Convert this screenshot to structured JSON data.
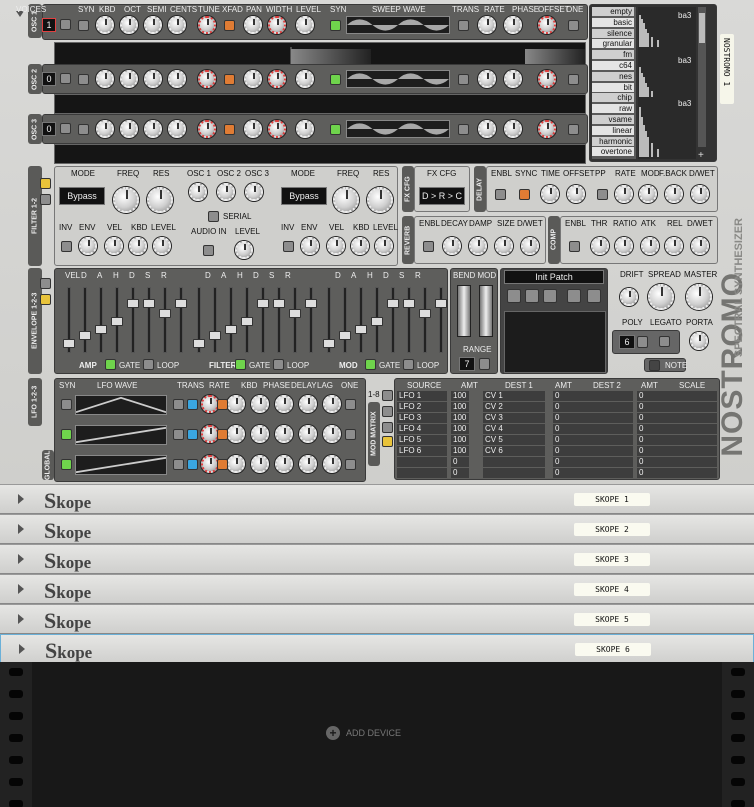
{
  "osc_labels": {
    "voices": "VOICES",
    "syn": "SYN",
    "kbd": "KBD",
    "oct": "OCT",
    "semi": "SEMI",
    "cents": "CENTS",
    "tune": "TUNE",
    "xfad": "XFAD",
    "pan": "PAN",
    "width": "WIDTH",
    "level": "LEVEL",
    "syn2": "SYN",
    "sweep": "SWEEP WAVE",
    "trans": "TRANS",
    "rate": "RATE",
    "phase": "PHASE",
    "offset": "OFFSET",
    "one": "ONE"
  },
  "osc": [
    {
      "tab": "OSC 1",
      "value": "1"
    },
    {
      "tab": "OSC 2",
      "value": "0"
    },
    {
      "tab": "OSC 3",
      "value": "0"
    }
  ],
  "wavelist": [
    "empty",
    "basic",
    "silence",
    "granular",
    "fm",
    "c64",
    "nes",
    "bit",
    "chip",
    "raw",
    "vsame",
    "linear",
    "harmonic",
    "overtone"
  ],
  "wavelist_right": [
    "ba3",
    "ba3",
    "ba3"
  ],
  "nostromo_label": "NOSTROMO 1",
  "filter": {
    "tab": "FILTER 1-2",
    "mode": "MODE",
    "freq": "FREQ",
    "res": "RES",
    "bypass1": "Bypass",
    "bypass2": "Bypass",
    "inv": "INV",
    "env": "ENV",
    "vel": "VEL",
    "kbd": "KBD",
    "level": "LEVEL",
    "osc1": "OSC 1",
    "osc2": "OSC 2",
    "osc3": "OSC 3",
    "serial": "SERIAL",
    "audio_in": "AUDIO IN",
    "level2": "LEVEL"
  },
  "fxcfg": {
    "tab": "FX CFG",
    "label": "FX CFG",
    "value": "D > R > C"
  },
  "delay": {
    "tab": "DELAY",
    "enbl": "ENBL",
    "sync": "SYNC",
    "time": "TIME",
    "offset": "OFFSET",
    "pp": "PP",
    "rate": "RATE",
    "mod": "MOD",
    "fback": "F.BACK",
    "dwet": "D/WET"
  },
  "reverb": {
    "tab": "REVERB",
    "enbl": "ENBL",
    "decay": "DECAY",
    "damp": "DAMP",
    "size": "SIZE",
    "dwet": "D/WET"
  },
  "comp": {
    "tab": "COMP",
    "enbl": "ENBL",
    "thr": "THR",
    "ratio": "RATIO",
    "atk": "ATK",
    "rel": "REL",
    "dwet": "D/WET"
  },
  "envelope": {
    "tab": "ENVELOPE 1-2-3",
    "cols": [
      "VEL",
      "D",
      "A",
      "H",
      "D",
      "S",
      "R"
    ],
    "amp": "AMP",
    "filter": "FILTER",
    "mod": "MOD",
    "gate": "GATE",
    "loop": "LOOP"
  },
  "bend": {
    "label": "BEND MOD",
    "range": "RANGE",
    "range_value": "7"
  },
  "patch": {
    "name": "Init Patch"
  },
  "master": {
    "drift": "DRIFT",
    "spread": "SPREAD",
    "master": "MASTER",
    "poly": "POLY",
    "legato": "LEGATO",
    "porta": "PORTA",
    "poly_value": "6",
    "note": "NOTE"
  },
  "lfo": {
    "tab": "LFO 1-2-3",
    "global": "GLOBAL",
    "syn": "SYN",
    "wave": "LFO WAVE",
    "trans": "TRANS",
    "rate": "RATE",
    "kbd": "KBD",
    "phase": "PHASE",
    "delay": "DELAY",
    "lag": "LAG",
    "one": "ONE"
  },
  "modmatrix": {
    "tab": "MOD MATRIX",
    "tab2": "1-8",
    "headers": [
      "SOURCE",
      "AMT",
      "DEST 1",
      "AMT",
      "DEST 2",
      "AMT",
      "SCALE"
    ],
    "rows": [
      {
        "src": "LFO 1",
        "amt": "100",
        "dest": "CV 1",
        "amt2": "0",
        "amt3": "0"
      },
      {
        "src": "LFO 2",
        "amt": "100",
        "dest": "CV 2",
        "amt2": "0",
        "amt3": "0"
      },
      {
        "src": "LFO 3",
        "amt": "100",
        "dest": "CV 3",
        "amt2": "0",
        "amt3": "0"
      },
      {
        "src": "LFO 4",
        "amt": "100",
        "dest": "CV 4",
        "amt2": "0",
        "amt3": "0"
      },
      {
        "src": "LFO 5",
        "amt": "100",
        "dest": "CV 5",
        "amt2": "0",
        "amt3": "0"
      },
      {
        "src": "LFO 6",
        "amt": "100",
        "dest": "CV 6",
        "amt2": "0",
        "amt3": "0"
      },
      {
        "src": "",
        "amt": "0",
        "dest": "",
        "amt2": "0",
        "amt3": "0"
      },
      {
        "src": "",
        "amt": "0",
        "dest": "",
        "amt2": "0",
        "amt3": "0"
      }
    ]
  },
  "brand": {
    "title": "NOSTROMO",
    "subtitle": "SPECTRAL SYNTHESIZER"
  },
  "skopes": [
    {
      "logo_s": "S",
      "logo": "kope",
      "tag": "SKOPE 1"
    },
    {
      "logo_s": "S",
      "logo": "kope",
      "tag": "SKOPE 2"
    },
    {
      "logo_s": "S",
      "logo": "kope",
      "tag": "SKOPE 3"
    },
    {
      "logo_s": "S",
      "logo": "kope",
      "tag": "SKOPE 4"
    },
    {
      "logo_s": "S",
      "logo": "kope",
      "tag": "SKOPE 5"
    },
    {
      "logo_s": "S",
      "logo": "kope",
      "tag": "SKOPE 6"
    }
  ],
  "rack": {
    "add_device": "ADD DEVICE"
  }
}
